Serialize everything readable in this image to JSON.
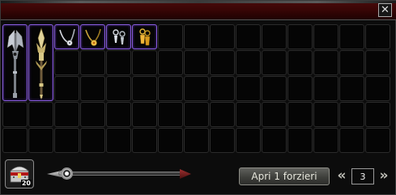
{
  "window": {
    "close_label": "✕"
  },
  "inventory": {
    "columns": 15,
    "rows": 5,
    "items": [
      {
        "name": "axe-weapon-icon",
        "tall": true
      },
      {
        "name": "spear-weapon-icon",
        "tall": true
      },
      {
        "name": "silver-necklace-icon",
        "tall": false
      },
      {
        "name": "gold-necklace-icon",
        "tall": false
      },
      {
        "name": "silver-earrings-icon",
        "tall": false
      },
      {
        "name": "gold-earrings-icon",
        "tall": false
      }
    ]
  },
  "chest": {
    "count": "20",
    "icon": "treasure-chest-icon"
  },
  "slider": {
    "value_fraction": 0.06
  },
  "actions": {
    "open_label": "Apri 1 forzieri"
  },
  "quantity": {
    "value": "3",
    "prev_label": "«",
    "next_label": "»"
  },
  "colors": {
    "title_red": "#3a0606",
    "item_border": "#8a5de0"
  }
}
